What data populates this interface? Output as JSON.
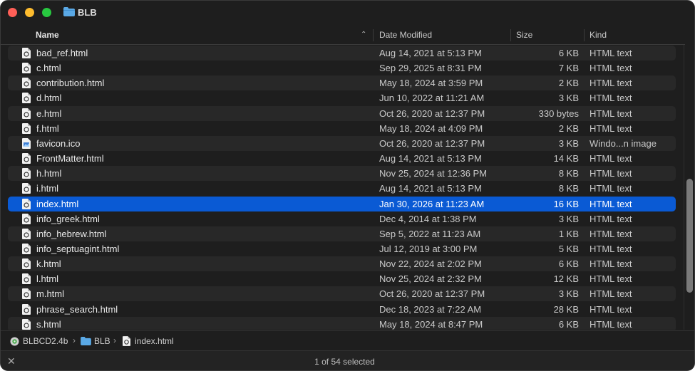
{
  "window": {
    "title": "BLB"
  },
  "columns": {
    "name": "Name",
    "date": "Date Modified",
    "size": "Size",
    "kind": "Kind"
  },
  "files": [
    {
      "name": "bad_ref.html",
      "date": "Aug 14, 2021 at 5:13 PM",
      "size": "6 KB",
      "kind": "HTML text",
      "icon": "html-file-icon"
    },
    {
      "name": "c.html",
      "date": "Sep 29, 2025 at 8:31 PM",
      "size": "7 KB",
      "kind": "HTML text",
      "icon": "html-file-icon"
    },
    {
      "name": "contribution.html",
      "date": "May 18, 2024 at 3:59 PM",
      "size": "2 KB",
      "kind": "HTML text",
      "icon": "html-file-icon"
    },
    {
      "name": "d.html",
      "date": "Jun 10, 2022 at 11:21 AM",
      "size": "3 KB",
      "kind": "HTML text",
      "icon": "html-file-icon"
    },
    {
      "name": "e.html",
      "date": "Oct 26, 2020 at 12:37 PM",
      "size": "330 bytes",
      "kind": "HTML text",
      "icon": "html-file-icon"
    },
    {
      "name": "f.html",
      "date": "May 18, 2024 at 4:09 PM",
      "size": "2 KB",
      "kind": "HTML text",
      "icon": "html-file-icon"
    },
    {
      "name": "favicon.ico",
      "date": "Oct 26, 2020 at 12:37 PM",
      "size": "3 KB",
      "kind": "Windo...n image",
      "icon": "image-file-icon"
    },
    {
      "name": "FrontMatter.html",
      "date": "Aug 14, 2021 at 5:13 PM",
      "size": "14 KB",
      "kind": "HTML text",
      "icon": "html-file-icon"
    },
    {
      "name": "h.html",
      "date": "Nov 25, 2024 at 12:36 PM",
      "size": "8 KB",
      "kind": "HTML text",
      "icon": "html-file-icon"
    },
    {
      "name": "i.html",
      "date": "Aug 14, 2021 at 5:13 PM",
      "size": "8 KB",
      "kind": "HTML text",
      "icon": "html-file-icon"
    },
    {
      "name": "index.html",
      "date": "Jan 30, 2026 at 11:23 AM",
      "size": "16 KB",
      "kind": "HTML text",
      "icon": "html-file-icon",
      "selected": true
    },
    {
      "name": "info_greek.html",
      "date": "Dec 4, 2014 at 1:38 PM",
      "size": "3 KB",
      "kind": "HTML text",
      "icon": "html-file-icon"
    },
    {
      "name": "info_hebrew.html",
      "date": "Sep 5, 2022 at 11:23 AM",
      "size": "1 KB",
      "kind": "HTML text",
      "icon": "html-file-icon"
    },
    {
      "name": "info_septuagint.html",
      "date": "Jul 12, 2019 at 3:00 PM",
      "size": "5 KB",
      "kind": "HTML text",
      "icon": "html-file-icon"
    },
    {
      "name": "k.html",
      "date": "Nov 22, 2024 at 2:02 PM",
      "size": "6 KB",
      "kind": "HTML text",
      "icon": "html-file-icon"
    },
    {
      "name": "l.html",
      "date": "Nov 25, 2024 at 2:32 PM",
      "size": "12 KB",
      "kind": "HTML text",
      "icon": "html-file-icon"
    },
    {
      "name": "m.html",
      "date": "Oct 26, 2020 at 12:37 PM",
      "size": "3 KB",
      "kind": "HTML text",
      "icon": "html-file-icon"
    },
    {
      "name": "phrase_search.html",
      "date": "Dec 18, 2023 at 7:22 AM",
      "size": "28 KB",
      "kind": "HTML text",
      "icon": "html-file-icon"
    },
    {
      "name": "s.html",
      "date": "May 18, 2024 at 8:47 PM",
      "size": "6 KB",
      "kind": "HTML text",
      "icon": "html-file-icon"
    }
  ],
  "pathbar": {
    "items": [
      {
        "label": "BLBCD2.4b",
        "icon": "disk-icon"
      },
      {
        "label": "BLB",
        "icon": "folder-icon"
      },
      {
        "label": "index.html",
        "icon": "html-file-icon"
      }
    ]
  },
  "status": {
    "text": "1 of 54 selected"
  },
  "colors": {
    "selection": "#0a5ad4",
    "folder": "#5aa9e6",
    "close": "#ff5f57",
    "minimize": "#febc2e",
    "maximize": "#28c840"
  }
}
